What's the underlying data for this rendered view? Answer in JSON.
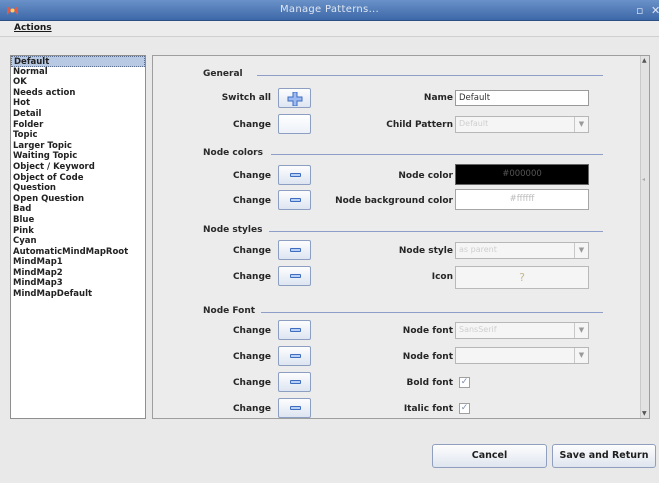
{
  "window": {
    "title": "Manage Patterns..."
  },
  "menubar": {
    "actions": "Actions"
  },
  "pattern_list": [
    "Default",
    "Normal",
    "OK",
    "Needs action",
    "Hot",
    "Detail",
    "Folder",
    "Topic",
    "Larger Topic",
    "Waiting Topic",
    "Object / Keyword",
    "Object of Code",
    "Question",
    "Open Question",
    "Bad",
    "Blue",
    "Pink",
    "Cyan",
    "AutomaticMindMapRoot",
    "MindMap1",
    "MindMap2",
    "MindMap3",
    "MindMapDefault"
  ],
  "selected_pattern": "Default",
  "general": {
    "section": "General",
    "switch_all_label": "Switch all",
    "change_label": "Change",
    "name_label": "Name",
    "name_value": "Default",
    "child_pattern_label": "Child Pattern",
    "child_pattern_value": "Default"
  },
  "node_colors": {
    "section": "Node colors",
    "change1": "Change",
    "change2": "Change",
    "node_color_label": "Node color",
    "node_color_value": "#000000",
    "bg_label": "Node background color",
    "bg_value": "#ffffff",
    "node_color_hex": "#000000",
    "bg_hex": "#ffffff"
  },
  "node_styles": {
    "section": "Node styles",
    "change1": "Change",
    "change2": "Change",
    "style_label": "Node style",
    "style_value": "as parent",
    "icon_label": "Icon",
    "icon_value": "?"
  },
  "node_font": {
    "section": "Node Font",
    "change1": "Change",
    "change2": "Change",
    "change3": "Change",
    "change4": "Change",
    "font_label": "Node font",
    "font_value": "SansSerif",
    "size_label": "Node font",
    "size_value": "",
    "bold_label": "Bold font",
    "bold_checked": "✓",
    "italic_label": "Italic font",
    "italic_checked": "✓"
  },
  "footer": {
    "cancel": "Cancel",
    "save": "Save and Return"
  },
  "colors": {
    "accent": "#3d68a8",
    "selection": "#b8c9e3"
  }
}
